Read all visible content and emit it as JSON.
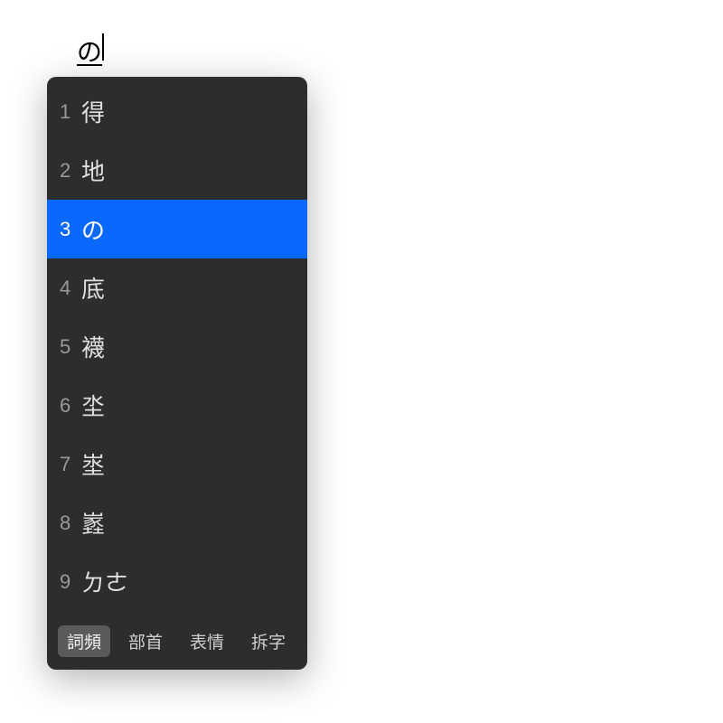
{
  "input": {
    "composition_text": "の"
  },
  "ime": {
    "candidates": [
      {
        "index": "1",
        "text": "得",
        "selected": false
      },
      {
        "index": "2",
        "text": "地",
        "selected": false
      },
      {
        "index": "3",
        "text": "の",
        "selected": true
      },
      {
        "index": "4",
        "text": "底",
        "selected": false
      },
      {
        "index": "5",
        "text": "襪",
        "selected": false
      },
      {
        "index": "6",
        "text": "坔",
        "selected": false
      },
      {
        "index": "7",
        "text": "埊",
        "selected": false
      },
      {
        "index": "8",
        "text": "嶳",
        "selected": false
      },
      {
        "index": "9",
        "text": "ㄉㄜ",
        "selected": false
      }
    ],
    "tabs": [
      {
        "label": "詞頻",
        "active": true
      },
      {
        "label": "部首",
        "active": false
      },
      {
        "label": "表情",
        "active": false
      },
      {
        "label": "拆字",
        "active": false
      }
    ]
  },
  "colors": {
    "panel_bg": "#2d2d2d",
    "selected_bg": "#0969ff",
    "tab_active_bg": "#5a5a5a"
  }
}
